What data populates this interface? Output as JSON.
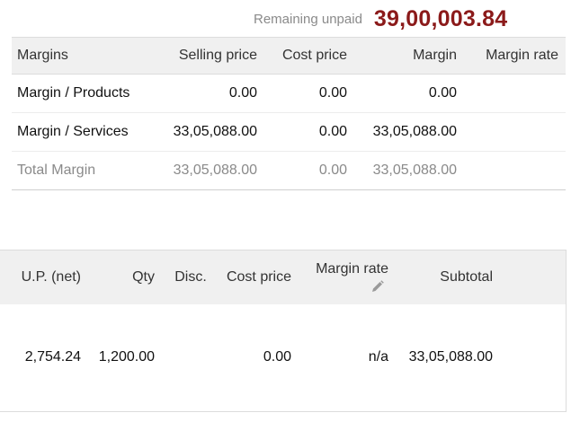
{
  "summary": {
    "remaining_label": "Remaining unpaid",
    "remaining_amount": "39,00,003.84",
    "amount_color": "#8b1a1a"
  },
  "margins_table": {
    "headers": [
      "Margins",
      "Selling price",
      "Cost price",
      "Margin",
      "Margin rate"
    ],
    "rows": [
      {
        "name": "Margin / Products",
        "selling": "0.00",
        "cost": "0.00",
        "margin": "0.00",
        "rate": ""
      },
      {
        "name": "Margin / Services",
        "selling": "33,05,088.00",
        "cost": "0.00",
        "margin": "33,05,088.00",
        "rate": ""
      },
      {
        "name": "Total Margin",
        "selling": "33,05,088.00",
        "cost": "0.00",
        "margin": "33,05,088.00",
        "rate": ""
      }
    ]
  },
  "lines_table": {
    "headers": [
      "U.P. (net)",
      "Qty",
      "Disc.",
      "Cost price",
      "Margin rate",
      "Subtotal"
    ],
    "edit_icon": "pencil-icon",
    "rows": [
      {
        "up_net": "2,754.24",
        "qty": "1,200.00",
        "disc": "",
        "cost": "0.00",
        "rate": "n/a",
        "subtotal": "33,05,088.00"
      }
    ]
  }
}
